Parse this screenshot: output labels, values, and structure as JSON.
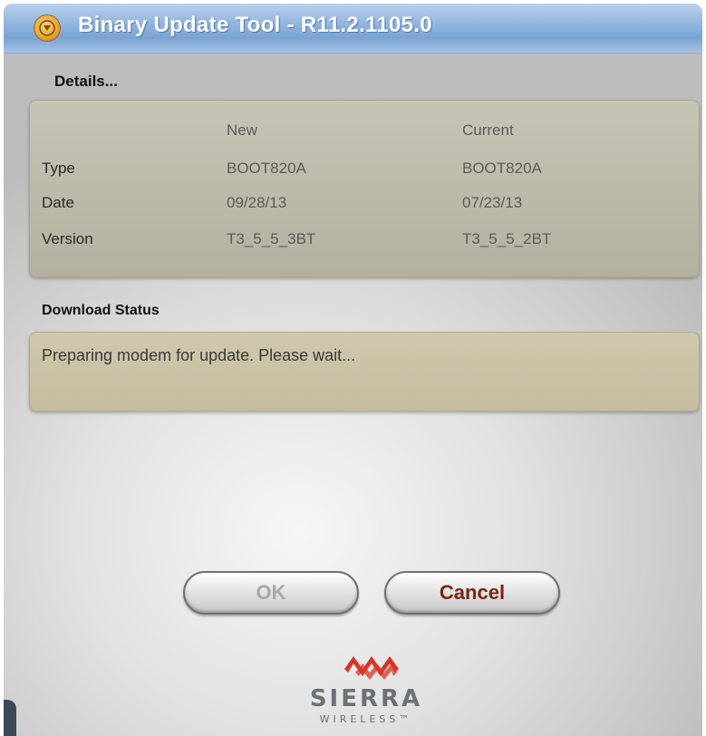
{
  "window": {
    "title": "Binary Update Tool - R11.2.1105.0"
  },
  "details": {
    "label": "Details...",
    "columns": [
      "",
      "New",
      "Current"
    ],
    "rows": [
      {
        "label": "Type",
        "new": "BOOT820A",
        "current": "BOOT820A"
      },
      {
        "label": "Date",
        "new": "09/28/13",
        "current": "07/23/13"
      },
      {
        "label": "Version",
        "new": "T3_5_5_3BT",
        "current": "T3_5_5_2BT"
      }
    ]
  },
  "download": {
    "label": "Download Status",
    "status_text": "Preparing modem for update.  Please wait..."
  },
  "buttons": {
    "ok_label": "OK",
    "cancel_label": "Cancel"
  },
  "logo": {
    "name": "SIERRA",
    "sub": "WIRELESS™"
  },
  "colors": {
    "title_bar": "#93b6de",
    "details_panel": "#bcb9a8",
    "status_panel": "#c9c2a5",
    "cancel_text": "#7a2416",
    "ok_text_disabled": "#a8a8a8",
    "logo_red": "#d8352a"
  },
  "icons": {
    "app": "download-arrow-icon",
    "logo_mark": "sierra-wave-icon"
  }
}
